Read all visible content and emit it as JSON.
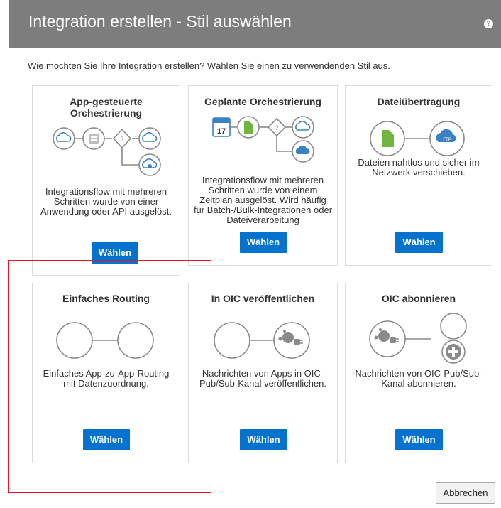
{
  "dialog": {
    "title": "Integration erstellen - Stil auswählen",
    "help_icon": "help-icon",
    "intro": "Wie möchten Sie Ihre Integration erstellen? Wählen Sie einen zu verwendenden Stil aus.",
    "cancel_label": "Abbrechen"
  },
  "cards": [
    {
      "title": "App-gesteuerte Orchestrierung",
      "description": "Integrationsflow mit mehreren Schritten wurde von einer Anwendung oder API ausgelöst.",
      "button": "Wählen",
      "icon": "app-driven-orchestration-icon"
    },
    {
      "title": "Geplante Orchestrierung",
      "description": "Integrationsflow mit mehreren Schritten wurde von einem Zeitplan ausgelöst. Wird häufig für Batch-/Bulk-Integrationen oder Dateiverarbeitung",
      "button": "Wählen",
      "icon": "scheduled-orchestration-icon",
      "calendar_day": "17"
    },
    {
      "title": "Dateiübertragung",
      "description": "Dateien nahtlos und sicher im Netzwerk verschieben.",
      "button": "Wählen",
      "icon": "file-transfer-icon",
      "ftp_label": "FTP"
    },
    {
      "title": "Einfaches Routing",
      "description": "Einfaches App-zu-App-Routing mit Datenzuordnung.",
      "button": "Wählen",
      "icon": "basic-routing-icon"
    },
    {
      "title": "In OIC veröffentlichen",
      "description": "Nachrichten von Apps in OIC-Pub/Sub-Kanal veröffentlichen.",
      "button": "Wählen",
      "icon": "publish-to-oic-icon"
    },
    {
      "title": "OIC abonnieren",
      "description": "Nachrichten von OIC-Pub/Sub-Kanal abonnieren.",
      "button": "Wählen",
      "icon": "subscribe-to-oic-icon"
    }
  ],
  "colors": {
    "header": "#7d7d7d",
    "button": "#0572ce",
    "icon_stroke": "#8a8a8a",
    "icon_blue": "#3b82c4",
    "icon_green": "#6fb53f",
    "highlight": "#e0162b"
  }
}
